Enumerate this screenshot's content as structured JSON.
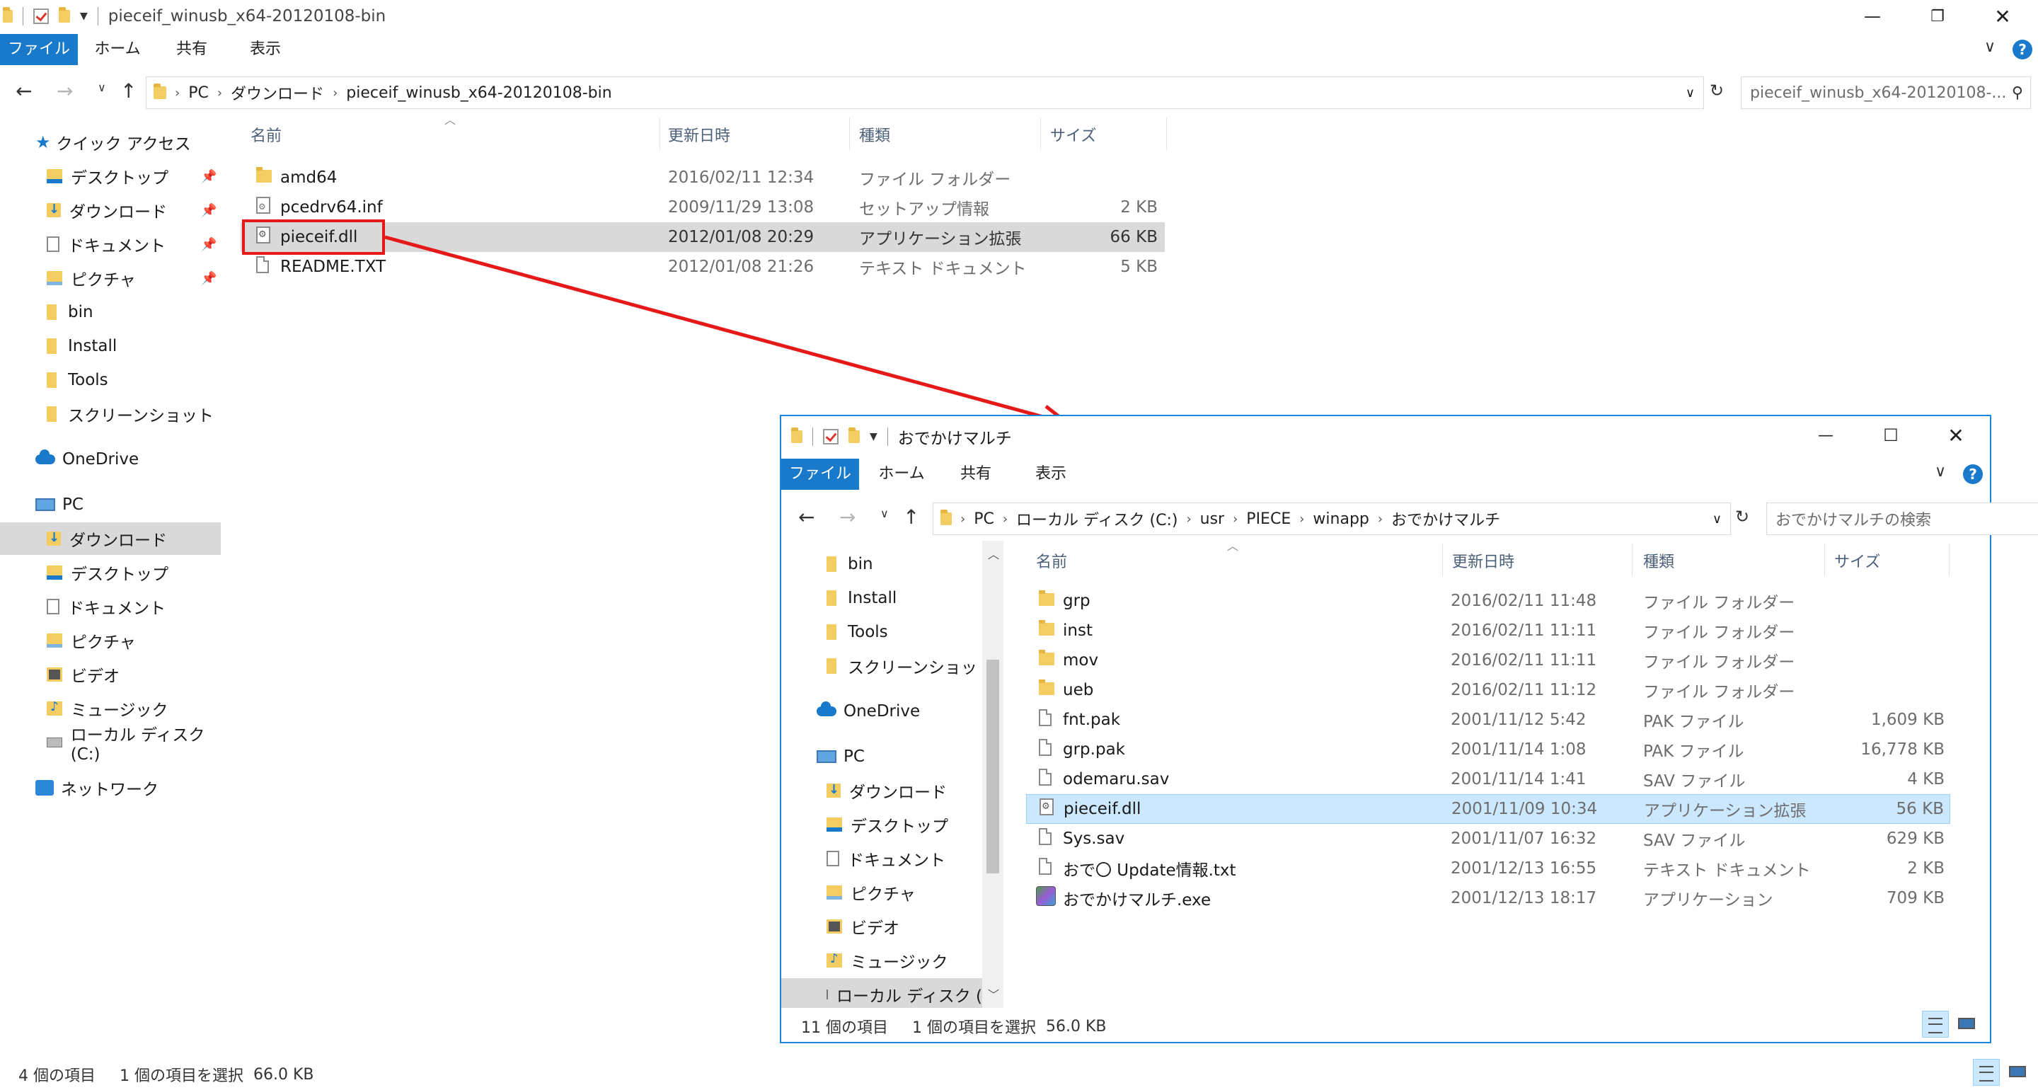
{
  "main": {
    "title": "pieceif_winusb_x64-20120108-bin",
    "ribbon_tabs": [
      "ファイル",
      "ホーム",
      "共有",
      "表示"
    ],
    "breadcrumb": [
      "PC",
      "ダウンロード",
      "pieceif_winusb_x64-20120108-bin"
    ],
    "search_placeholder": "pieceif_winusb_x64-20120108-...",
    "columns": [
      "名前",
      "更新日時",
      "種類",
      "サイズ"
    ],
    "nav": {
      "quick_access": "クイック アクセス",
      "quick_items": [
        "デスクトップ",
        "ダウンロード",
        "ドキュメント",
        "ピクチャ",
        "bin",
        "Install",
        "Tools",
        "スクリーンショット"
      ],
      "onedrive": "OneDrive",
      "pc": "PC",
      "pc_items": [
        "ダウンロード",
        "デスクトップ",
        "ドキュメント",
        "ピクチャ",
        "ビデオ",
        "ミュージック",
        "ローカル ディスク (C:)"
      ],
      "network": "ネットワーク"
    },
    "files": [
      {
        "name": "amd64",
        "date": "2016/02/11 12:34",
        "type": "ファイル フォルダー",
        "size": "",
        "icon": "folder-icon"
      },
      {
        "name": "pcedrv64.inf",
        "date": "2009/11/29 13:08",
        "type": "セットアップ情報",
        "size": "2 KB",
        "icon": "setup-info-icon"
      },
      {
        "name": "pieceif.dll",
        "date": "2012/01/08 20:29",
        "type": "アプリケーション拡張",
        "size": "66 KB",
        "icon": "dll-icon"
      },
      {
        "name": "README.TXT",
        "date": "2012/01/08 21:26",
        "type": "テキスト ドキュメント",
        "size": "5 KB",
        "icon": "text-file-icon"
      }
    ],
    "status": {
      "count": "4 個の項目",
      "selected": "1 個の項目を選択",
      "size": "66.0 KB"
    }
  },
  "second": {
    "title": "おでかけマルチ",
    "ribbon_tabs": [
      "ファイル",
      "ホーム",
      "共有",
      "表示"
    ],
    "breadcrumb": [
      "PC",
      "ローカル ディスク (C:)",
      "usr",
      "PIECE",
      "winapp",
      "おでかけマルチ"
    ],
    "search_placeholder": "おでかけマルチの検索",
    "columns": [
      "名前",
      "更新日時",
      "種類",
      "サイズ"
    ],
    "nav": {
      "folders": [
        "bin",
        "Install",
        "Tools",
        "スクリーンショット"
      ],
      "onedrive": "OneDrive",
      "pc": "PC",
      "pc_items": [
        "ダウンロード",
        "デスクトップ",
        "ドキュメント",
        "ピクチャ",
        "ビデオ",
        "ミュージック",
        "ローカル ディスク (C:"
      ]
    },
    "files": [
      {
        "name": "grp",
        "date": "2016/02/11 11:48",
        "type": "ファイル フォルダー",
        "size": ""
      },
      {
        "name": "inst",
        "date": "2016/02/11 11:11",
        "type": "ファイル フォルダー",
        "size": ""
      },
      {
        "name": "mov",
        "date": "2016/02/11 11:11",
        "type": "ファイル フォルダー",
        "size": ""
      },
      {
        "name": "ueb",
        "date": "2016/02/11 11:12",
        "type": "ファイル フォルダー",
        "size": ""
      },
      {
        "name": "fnt.pak",
        "date": "2001/11/12 5:42",
        "type": "PAK ファイル",
        "size": "1,609 KB"
      },
      {
        "name": "grp.pak",
        "date": "2001/11/14 1:08",
        "type": "PAK ファイル",
        "size": "16,778 KB"
      },
      {
        "name": "odemaru.sav",
        "date": "2001/11/14 1:41",
        "type": "SAV ファイル",
        "size": "4 KB"
      },
      {
        "name": "pieceif.dll",
        "date": "2001/11/09 10:34",
        "type": "アプリケーション拡張",
        "size": "56 KB"
      },
      {
        "name": "Sys.sav",
        "date": "2001/11/07 16:32",
        "type": "SAV ファイル",
        "size": "629 KB"
      },
      {
        "name": "おで〇 Update情報.txt",
        "date": "2001/12/13 16:55",
        "type": "テキスト ドキュメント",
        "size": "2 KB"
      },
      {
        "name": "おでかけマルチ.exe",
        "date": "2001/12/13 18:17",
        "type": "アプリケーション",
        "size": "709 KB"
      }
    ],
    "status": {
      "count": "11 個の項目",
      "selected": "1 個の項目を選択",
      "size": "56.0 KB"
    }
  },
  "colors": {
    "accent": "#1979ca",
    "highlight_red": "#e61919",
    "selection_blue": "#cce8ff",
    "selection_gray": "#d9d9d9"
  }
}
